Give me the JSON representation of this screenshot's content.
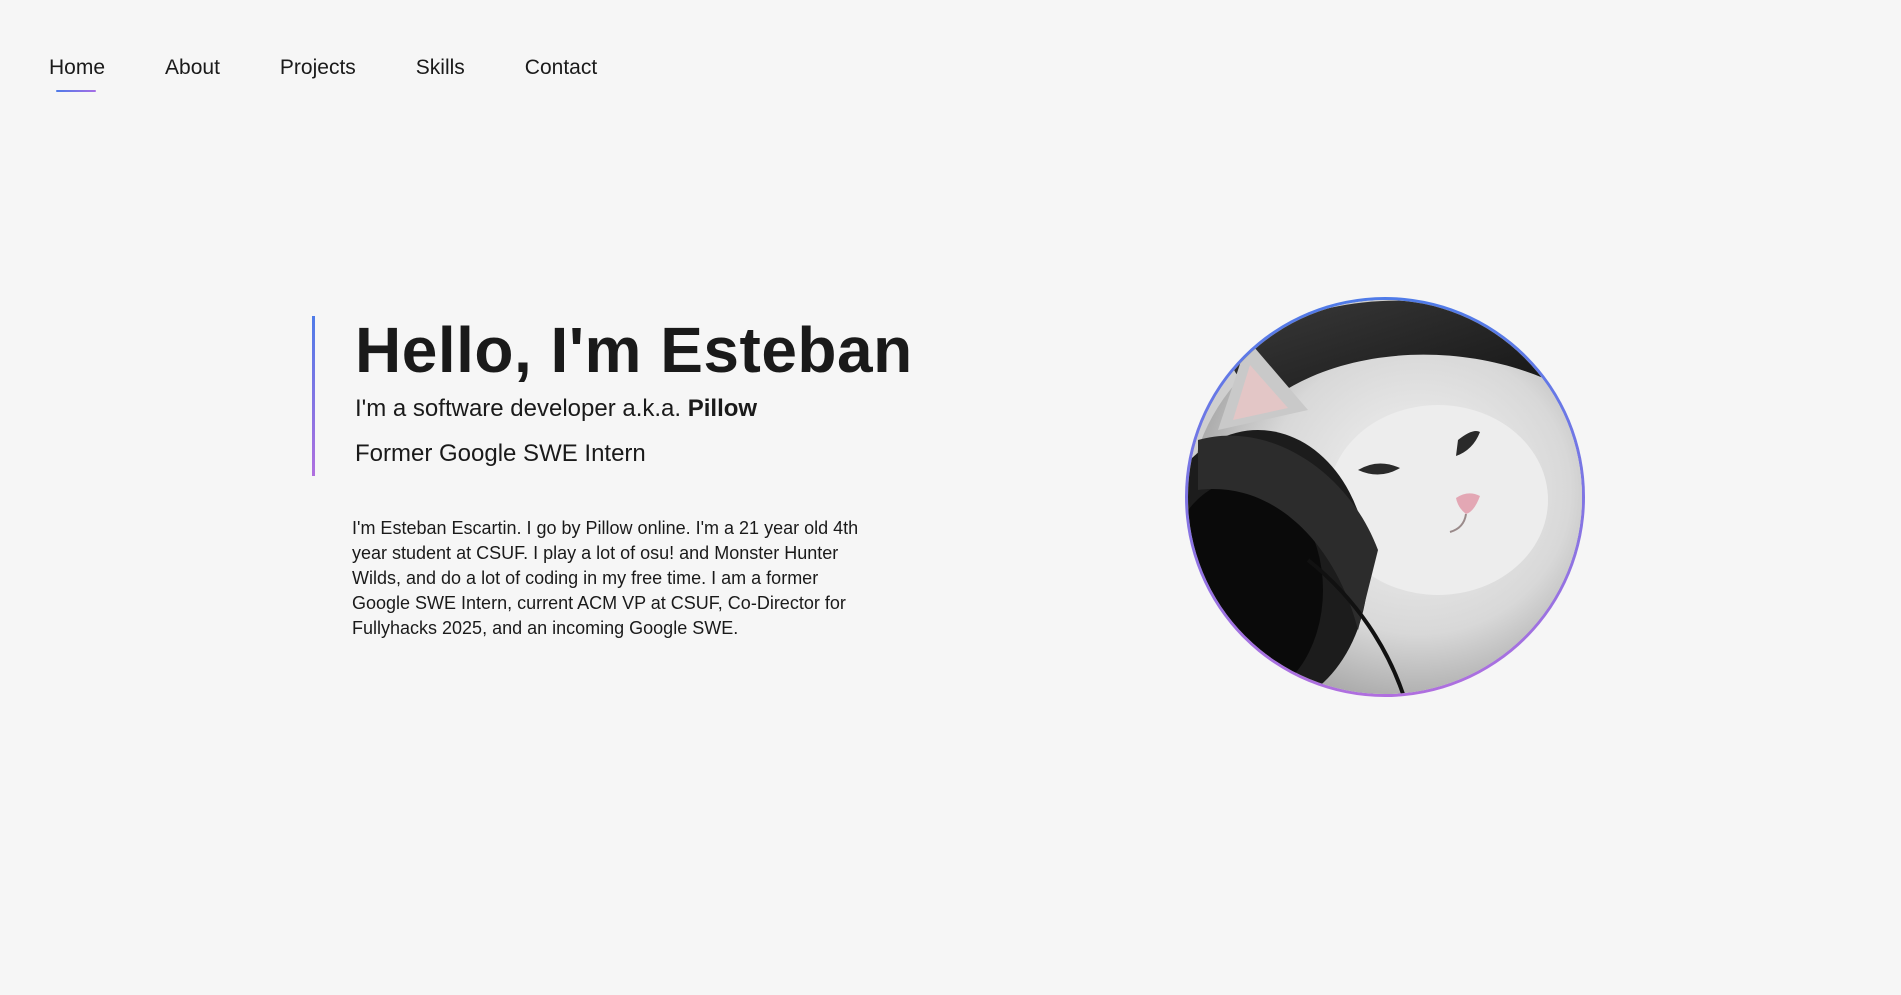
{
  "nav": {
    "items": [
      {
        "label": "Home",
        "active": true
      },
      {
        "label": "About",
        "active": false
      },
      {
        "label": "Projects",
        "active": false
      },
      {
        "label": "Skills",
        "active": false
      },
      {
        "label": "Contact",
        "active": false
      }
    ]
  },
  "hero": {
    "title": "Hello, I'm Esteban",
    "tagline_prefix": "I'm a software developer a.k.a. ",
    "tagline_name": "Pillow",
    "subtitle": "Former Google SWE Intern"
  },
  "bio": {
    "text": "I'm Esteban Escartin. I go by Pillow online. I'm a 21 year old 4th year student at CSUF. I play a lot of osu! and Monster Hunter Wilds, and do a lot of coding in my free time. I am a former Google SWE Intern, current ACM VP at CSUF, Co-Director for Fullyhacks 2025, and an incoming Google SWE."
  },
  "avatar": {
    "icon": "cat-with-headphones-avatar"
  },
  "colors": {
    "background": "#f6f6f6",
    "accent_start": "#4f7be8",
    "accent_end": "#b06fdf",
    "text": "#1a1a1a"
  }
}
